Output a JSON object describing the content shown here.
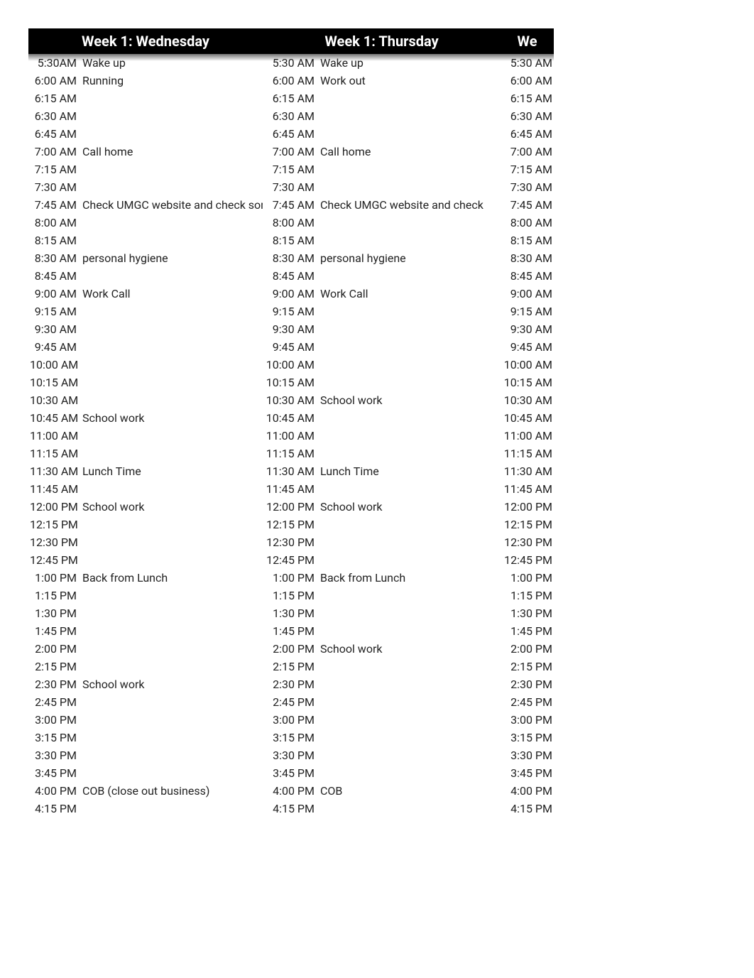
{
  "headers": [
    "Week 1: Wednesday",
    "Week 1: Thursday",
    "We"
  ],
  "columns": [
    {
      "times": [
        "5:30AM",
        "6:00 AM",
        "6:15 AM",
        "6:30 AM",
        "6:45 AM",
        "7:00 AM",
        "7:15 AM",
        "7:30 AM",
        "7:45 AM",
        "8:00 AM",
        "8:15 AM",
        "8:30 AM",
        "8:45 AM",
        "9:00 AM",
        "9:15 AM",
        "9:30 AM",
        "9:45 AM",
        "10:00 AM",
        "10:15 AM",
        "10:30 AM",
        "10:45 AM",
        "11:00 AM",
        "11:15 AM",
        "11:30 AM",
        "11:45 AM",
        "12:00 PM",
        "12:15 PM",
        "12:30 PM",
        "12:45 PM",
        "1:00 PM",
        "1:15 PM",
        "1:30 PM",
        "1:45 PM",
        "2:00 PM",
        "2:15 PM",
        "2:30 PM",
        "2:45 PM",
        "3:00 PM",
        "3:15 PM",
        "3:30 PM",
        "3:45 PM",
        "4:00 PM",
        "4:15 PM"
      ],
      "acts": [
        "Wake up",
        "Running",
        "",
        "",
        "",
        "Call home",
        "",
        "",
        "Check UMGC website and check som",
        "",
        "",
        "personal hygiene",
        "",
        "Work Call",
        "",
        "",
        "",
        "",
        "",
        "",
        "School work",
        "",
        "",
        "Lunch Time",
        "",
        "School work",
        "",
        "",
        "",
        "Back from Lunch",
        "",
        "",
        "",
        "",
        "",
        "School work",
        "",
        "",
        "",
        "",
        "",
        "COB (close out business)",
        ""
      ]
    },
    {
      "times": [
        "5:30 AM",
        "6:00 AM",
        "6:15 AM",
        "6:30 AM",
        "6:45 AM",
        "7:00 AM",
        "7:15 AM",
        "7:30 AM",
        "7:45 AM",
        "8:00 AM",
        "8:15 AM",
        "8:30 AM",
        "8:45 AM",
        "9:00 AM",
        "9:15 AM",
        "9:30 AM",
        "9:45 AM",
        "10:00 AM",
        "10:15 AM",
        "10:30 AM",
        "10:45 AM",
        "11:00 AM",
        "11:15 AM",
        "11:30 AM",
        "11:45 AM",
        "12:00 PM",
        "12:15 PM",
        "12:30 PM",
        "12:45 PM",
        "1:00 PM",
        "1:15 PM",
        "1:30 PM",
        "1:45 PM",
        "2:00 PM",
        "2:15 PM",
        "2:30 PM",
        "2:45 PM",
        "3:00 PM",
        "3:15 PM",
        "3:30 PM",
        "3:45 PM",
        "4:00 PM",
        "4:15 PM"
      ],
      "acts": [
        "Wake up",
        "Work out",
        "",
        "",
        "",
        "Call home",
        "",
        "",
        "Check UMGC website and check",
        "",
        "",
        "personal hygiene",
        "",
        "Work Call",
        "",
        "",
        "",
        "",
        "",
        "School work",
        "",
        "",
        "",
        "Lunch Time",
        "",
        "School work",
        "",
        "",
        "",
        "Back from Lunch",
        "",
        "",
        "",
        "School work",
        "",
        "",
        "",
        "",
        "",
        "",
        "",
        "COB",
        ""
      ]
    },
    {
      "times": [
        "5:30 AM",
        "6:00 AM",
        "6:15 AM",
        "6:30 AM",
        "6:45 AM",
        "7:00 AM",
        "7:15 AM",
        "7:30 AM",
        "7:45 AM",
        "8:00 AM",
        "8:15 AM",
        "8:30 AM",
        "8:45 AM",
        "9:00 AM",
        "9:15 AM",
        "9:30 AM",
        "9:45 AM",
        "10:00 AM",
        "10:15 AM",
        "10:30 AM",
        "10:45 AM",
        "11:00 AM",
        "11:15 AM",
        "11:30 AM",
        "11:45 AM",
        "12:00 PM",
        "12:15 PM",
        "12:30 PM",
        "12:45 PM",
        "1:00 PM",
        "1:15 PM",
        "1:30 PM",
        "1:45 PM",
        "2:00 PM",
        "2:15 PM",
        "2:30 PM",
        "2:45 PM",
        "3:00 PM",
        "3:15 PM",
        "3:30 PM",
        "3:45 PM",
        "4:00 PM",
        "4:15 PM"
      ]
    }
  ]
}
